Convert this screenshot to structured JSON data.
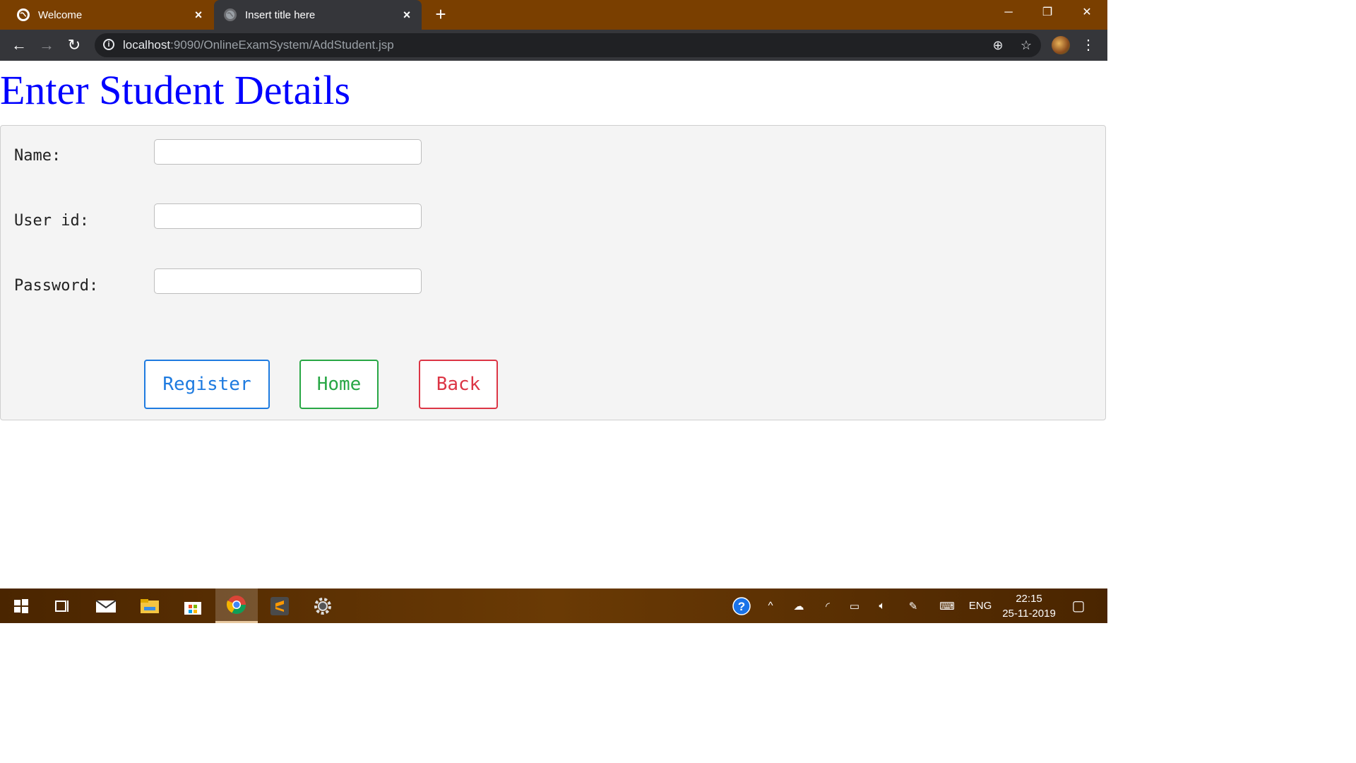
{
  "browser": {
    "tabs": [
      {
        "title": "Welcome",
        "active": false
      },
      {
        "title": "Insert title here",
        "active": true
      }
    ],
    "new_tab_label": "+",
    "address": {
      "host": "localhost",
      "rest": ":9090/OnlineExamSystem/AddStudent.jsp"
    },
    "window_controls": {
      "minimize": "─",
      "restore": "❐",
      "close": "✕"
    }
  },
  "page": {
    "title": "Enter Student Details",
    "fields": [
      {
        "label": "Name:",
        "value": ""
      },
      {
        "label": "User id:",
        "value": ""
      },
      {
        "label": "Password:",
        "value": ""
      }
    ],
    "buttons": {
      "register": "Register",
      "home": "Home",
      "back": "Back"
    }
  },
  "taskbar": {
    "apps": [
      "start-icon",
      "task-view-icon",
      "mail-icon",
      "file-explorer-icon",
      "store-icon",
      "chrome-icon",
      "sublime-text-icon",
      "settings-gear-icon"
    ],
    "active_app": "chrome-icon",
    "language": "ENG",
    "time": "22:15",
    "date": "25-11-2019"
  },
  "colors": {
    "title_blue": "#0000ff",
    "register": "#1e7be0",
    "home": "#28a745",
    "back": "#dc3545",
    "titlebar": "#7a3f00"
  }
}
